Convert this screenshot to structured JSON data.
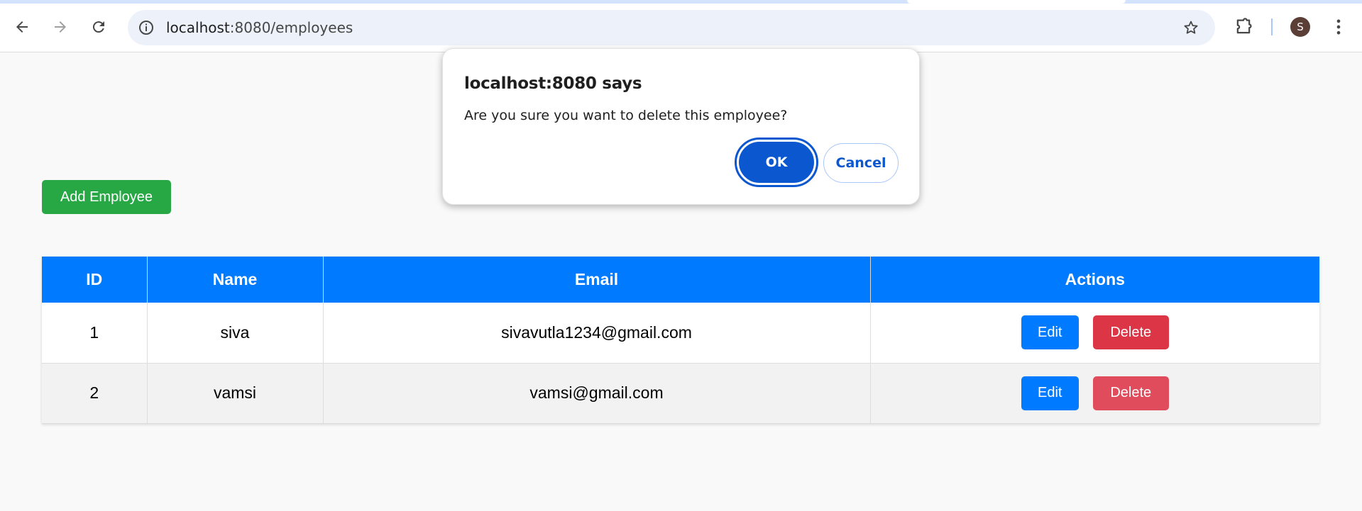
{
  "browser": {
    "url_host": "localhost",
    "url_path": ":8080/employees",
    "avatar_letter": "S"
  },
  "page": {
    "add_button_label": "Add Employee",
    "table": {
      "headers": [
        "ID",
        "Name",
        "Email",
        "Actions"
      ],
      "rows": [
        {
          "id": "1",
          "name": "siva",
          "email": "sivavutla1234@gmail.com",
          "edit": "Edit",
          "delete": "Delete"
        },
        {
          "id": "2",
          "name": "vamsi",
          "email": "vamsi@gmail.com",
          "edit": "Edit",
          "delete": "Delete"
        }
      ]
    }
  },
  "dialog": {
    "title": "localhost:8080 says",
    "message": "Are you sure you want to delete this employee?",
    "ok_label": "OK",
    "cancel_label": "Cancel"
  },
  "colors": {
    "add_button": "#28a745",
    "table_header": "#007bff",
    "edit_button": "#007bff",
    "delete_button": "#dc3545",
    "dialog_primary": "#0b57d0"
  }
}
